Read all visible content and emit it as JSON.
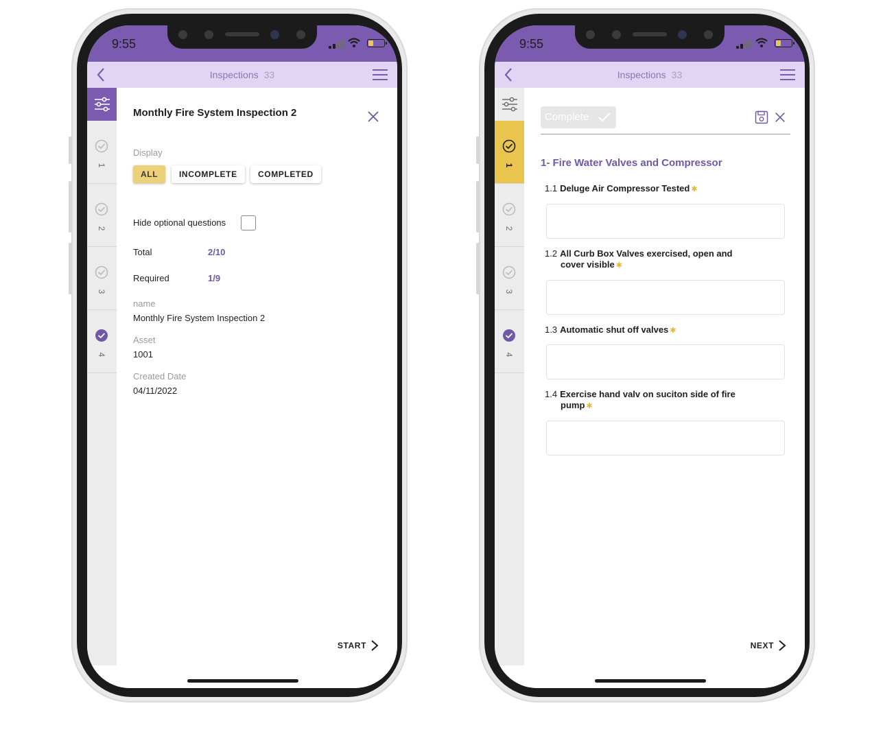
{
  "status": {
    "time": "9:55"
  },
  "nav": {
    "title": "Inspections",
    "count": "33"
  },
  "left": {
    "title": "Monthly Fire System Inspection 2",
    "display_label": "Display",
    "filters": [
      "ALL",
      "INCOMPLETE",
      "COMPLETED"
    ],
    "selected_filter": "ALL",
    "hide_optional_label": "Hide optional questions",
    "total_label": "Total",
    "total_value": "2/10",
    "required_label": "Required",
    "required_value": "1/9",
    "fields": [
      {
        "label": "name",
        "value": "Monthly Fire System Inspection 2"
      },
      {
        "label": "Asset",
        "value": "1001"
      },
      {
        "label": "Created Date",
        "value": "04/11/2022"
      }
    ],
    "start_label": "START"
  },
  "steps": [
    "1",
    "2",
    "3",
    "4"
  ],
  "right": {
    "complete_label": "Complete",
    "section_title": "1- Fire Water Valves and Compressor",
    "questions": [
      {
        "num": "1.1",
        "line1": "Deluge Air Compressor Tested",
        "line2": ""
      },
      {
        "num": "1.2",
        "line1": "All Curb Box Valves exercised, open and",
        "line2": "cover visible"
      },
      {
        "num": "1.3",
        "line1": "Automatic shut off valves",
        "line2": ""
      },
      {
        "num": "1.4",
        "line1": "Exercise hand valv on suciton side of fire",
        "line2": "pump"
      }
    ],
    "next_label": "NEXT"
  },
  "colors": {
    "status_bar": "#7b5bb0",
    "nav_bar": "#e2d5f3",
    "accent_purple": "#6f58a8",
    "accent_yellow": "#e9c54d",
    "rail": "#ececec"
  }
}
